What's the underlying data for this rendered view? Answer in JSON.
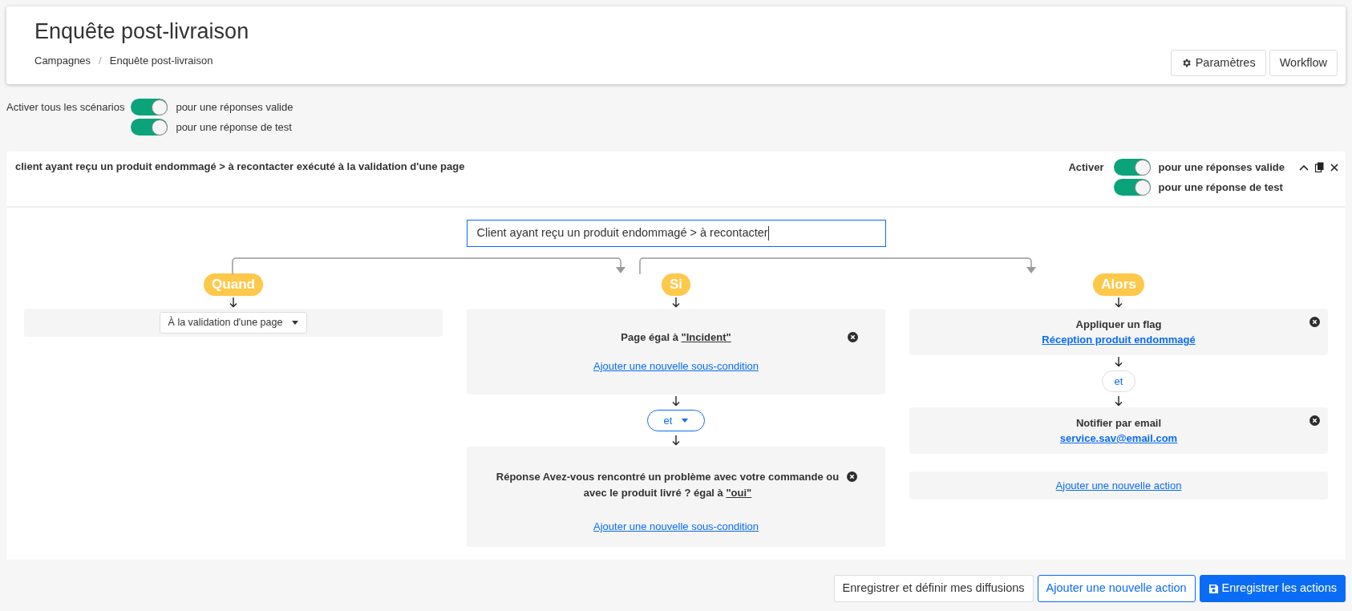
{
  "header": {
    "title": "Enquête post-livraison",
    "breadcrumbs": [
      "Campagnes",
      "Enquête post-livraison"
    ],
    "breadcrumb_separator": "/",
    "buttons": [
      {
        "label": "Paramètres",
        "kind": "settings"
      },
      {
        "label": "Workflow",
        "kind": "plain"
      }
    ]
  },
  "global_toggles": {
    "label": "Activer tous les scénarios",
    "toggles": [
      {
        "label": "pour une réponses valide",
        "on": true
      },
      {
        "label": "pour une réponse de test",
        "on": true
      }
    ]
  },
  "scenario": {
    "title": "client ayant reçu un produit endommagé > à recontacter exécuté à la validation d'une page",
    "activate_label": "Activer",
    "toggles": [
      {
        "label": "pour une réponses valide",
        "on": true
      },
      {
        "label": "pour une réponse de test",
        "on": true
      }
    ],
    "name_value": "Client ayant reçu un produit endommagé > à recontacter",
    "when": {
      "label": "Quand",
      "trigger": "À la validation d'une page"
    },
    "if": {
      "label": "Si",
      "conditions": [
        {
          "text": "Page égal à",
          "value": "\"Incident\"",
          "add_link": "Ajouter une nouvelle sous-condition"
        },
        {
          "text": "Réponse Avez-vous rencontré un problème avec votre commande ou avec le produit livré ? égal à",
          "value": "\"oui\"",
          "add_link": "Ajouter une nouvelle sous-condition"
        }
      ],
      "joiner": "et"
    },
    "then": {
      "label": "Alors",
      "actions": [
        {
          "title": "Appliquer un flag",
          "link": "Réception produit endommagé"
        },
        {
          "title": "Notifier par email",
          "link": "service.sav@email.com"
        }
      ],
      "joiner": "et",
      "add_action": "Ajouter une nouvelle action"
    }
  },
  "footer_buttons": [
    {
      "label": "Enregistrer et définir mes diffusions",
      "kind": "secondary"
    },
    {
      "label": "Ajouter une nouvelle action",
      "kind": "outline"
    },
    {
      "label": "Enregistrer les actions",
      "kind": "primary"
    }
  ]
}
